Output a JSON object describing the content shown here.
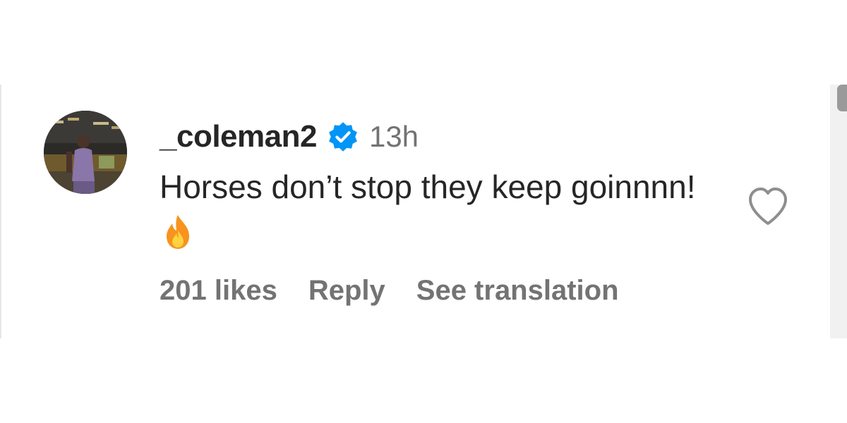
{
  "comment": {
    "username": "_coleman2",
    "verified": true,
    "timestamp": "13h",
    "text": "Horses don’t stop they keep goinnnn!",
    "emoji": "fire-icon",
    "likes_label": "201 likes",
    "reply_label": "Reply",
    "translation_label": "See translation",
    "liked": false
  },
  "colors": {
    "verified_badge": "#0095f6",
    "text_primary": "#262626",
    "text_secondary": "#737373",
    "fire_outer": "#f7931e",
    "fire_inner": "#ffd23f"
  },
  "icons": {
    "verified": "verified-badge-icon",
    "like": "heart-outline-icon",
    "emoji": "fire-icon",
    "avatar": "avatar"
  }
}
